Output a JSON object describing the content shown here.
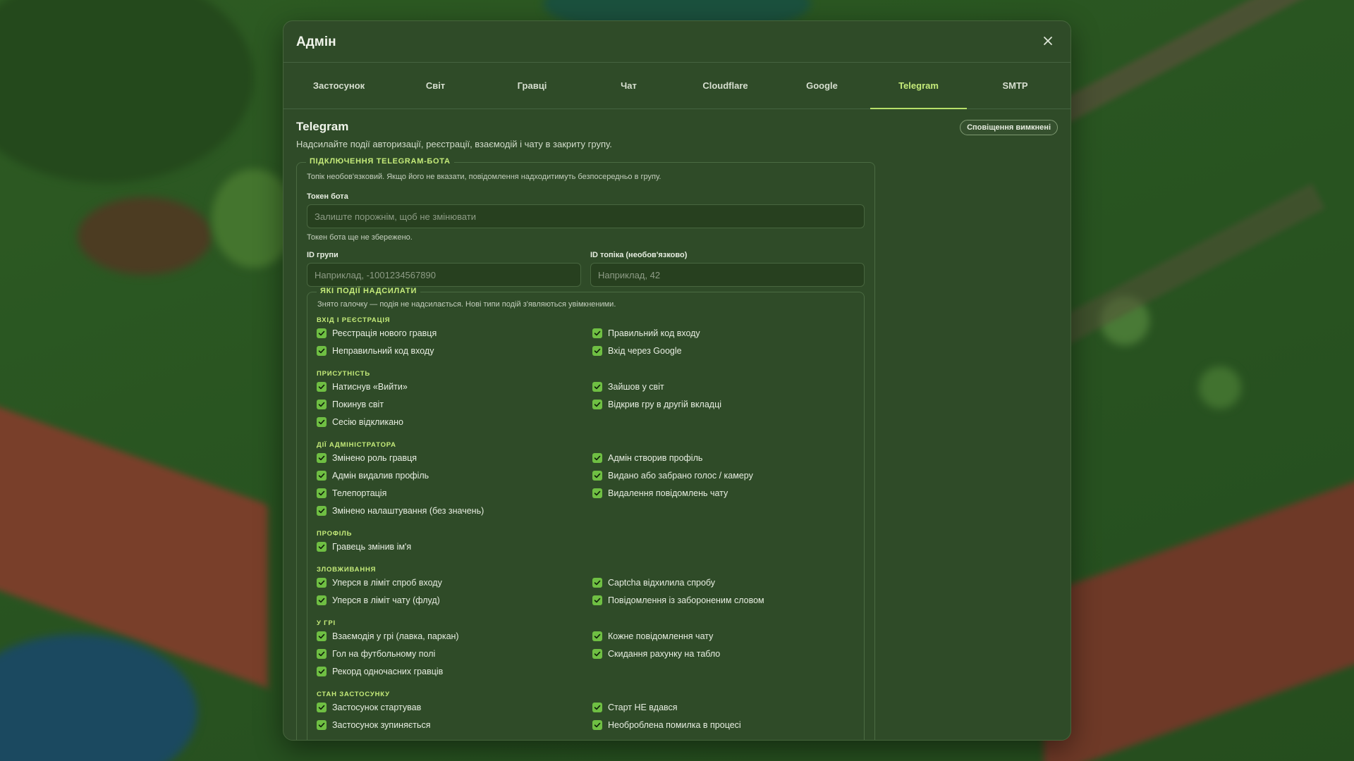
{
  "modal": {
    "title": "Адмін",
    "close_icon": "close-icon"
  },
  "tabs": [
    {
      "label": "Застосунок",
      "active": false
    },
    {
      "label": "Світ",
      "active": false
    },
    {
      "label": "Гравці",
      "active": false
    },
    {
      "label": "Чат",
      "active": false
    },
    {
      "label": "Cloudflare",
      "active": false
    },
    {
      "label": "Google",
      "active": false
    },
    {
      "label": "Telegram",
      "active": true
    },
    {
      "label": "SMTP",
      "active": false
    }
  ],
  "section": {
    "title": "Telegram",
    "description": "Надсилайте події авторизації, реєстрації, взаємодій і чату в закриту групу.",
    "badge": "Сповіщення вимкнені"
  },
  "bot": {
    "legend": "ПІДКЛЮЧЕННЯ TELEGRAM-БОТА",
    "hint": "Топік необов'язковий. Якщо його не вказати, повідомлення надходитимуть безпосередньо в групу.",
    "token_label": "Токен бота",
    "token_placeholder": "Залиште порожнім, щоб не змінювати",
    "token_hint": "Токен бота ще не збережено.",
    "group_label": "ID групи",
    "group_placeholder": "Наприклад, -1001234567890",
    "topic_label": "ID топіка (необов'язково)",
    "topic_placeholder": "Наприклад, 42"
  },
  "events": {
    "legend": "ЯКІ ПОДІЇ НАДСИЛАТИ",
    "hint": "Знято галочку — подія не надсилається. Нові типи подій з'являються увімкненими.",
    "groups": [
      {
        "title": "ВХІД І РЕЄСТРАЦІЯ",
        "items": [
          {
            "label": "Реєстрація нового гравця",
            "checked": true
          },
          {
            "label": "Правильний код входу",
            "checked": true
          },
          {
            "label": "Неправильний код входу",
            "checked": true
          },
          {
            "label": "Вхід через Google",
            "checked": true
          }
        ]
      },
      {
        "title": "ПРИСУТНІСТЬ",
        "items": [
          {
            "label": "Натиснув «Вийти»",
            "checked": true
          },
          {
            "label": "Зайшов у світ",
            "checked": true
          },
          {
            "label": "Покинув світ",
            "checked": true
          },
          {
            "label": "Відкрив гру в другій вкладці",
            "checked": true
          },
          {
            "label": "Сесію відкликано",
            "checked": true
          }
        ]
      },
      {
        "title": "ДІЇ АДМІНІСТРАТОРА",
        "items": [
          {
            "label": "Змінено роль гравця",
            "checked": true
          },
          {
            "label": "Адмін створив профіль",
            "checked": true
          },
          {
            "label": "Адмін видалив профіль",
            "checked": true
          },
          {
            "label": "Видано або забрано голос / камеру",
            "checked": true
          },
          {
            "label": "Телепортація",
            "checked": true
          },
          {
            "label": "Видалення повідомлень чату",
            "checked": true
          },
          {
            "label": "Змінено налаштування (без значень)",
            "checked": true
          }
        ]
      },
      {
        "title": "ПРОФІЛЬ",
        "items": [
          {
            "label": "Гравець змінив ім'я",
            "checked": true
          }
        ]
      },
      {
        "title": "ЗЛОВЖИВАННЯ",
        "items": [
          {
            "label": "Уперся в ліміт спроб входу",
            "checked": true
          },
          {
            "label": "Captcha відхилила спробу",
            "checked": true
          },
          {
            "label": "Уперся в ліміт чату (флуд)",
            "checked": true
          },
          {
            "label": "Повідомлення із забороненим словом",
            "checked": true
          }
        ]
      },
      {
        "title": "У ГРІ",
        "items": [
          {
            "label": "Взаємодія у грі (лавка, паркан)",
            "checked": true
          },
          {
            "label": "Кожне повідомлення чату",
            "checked": true
          },
          {
            "label": "Гол на футбольному полі",
            "checked": true
          },
          {
            "label": "Скидання рахунку на табло",
            "checked": true
          },
          {
            "label": "Рекорд одночасних гравців",
            "checked": true
          }
        ]
      },
      {
        "title": "СТАН ЗАСТОСУНКУ",
        "items": [
          {
            "label": "Застосунок стартував",
            "checked": true
          },
          {
            "label": "Старт НЕ вдався",
            "checked": true
          },
          {
            "label": "Застосунок зупиняється",
            "checked": true
          },
          {
            "label": "Необроблена помилка в процесі",
            "checked": true
          }
        ]
      }
    ]
  },
  "colors": {
    "accent": "#c6ec7a",
    "checkbox": "#6fbf43",
    "modal_bg": "#2f4b28"
  }
}
